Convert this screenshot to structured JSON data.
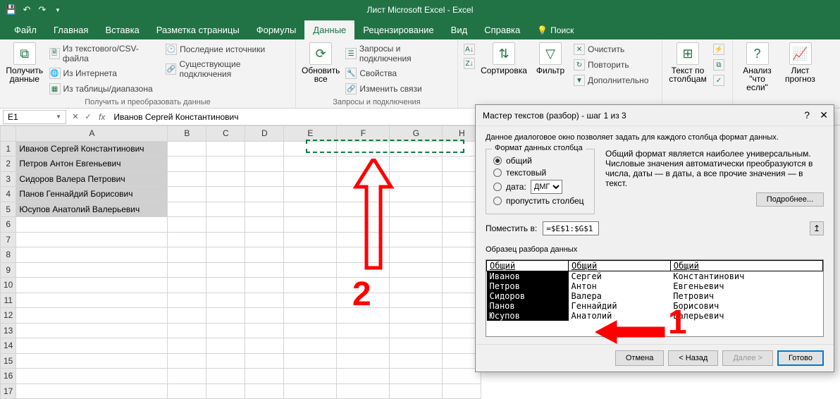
{
  "title": "Лист Microsoft Excel  -  Excel",
  "tabs": {
    "file": "Файл",
    "home": "Главная",
    "insert": "Вставка",
    "layout": "Разметка страницы",
    "formulas": "Формулы",
    "data": "Данные",
    "review": "Рецензирование",
    "view": "Вид",
    "help": "Справка",
    "search": "Поиск"
  },
  "ribbon": {
    "getdata": {
      "big": "Получить данные",
      "a": "Из текстового/CSV-файла",
      "b": "Из Интернета",
      "c": "Из таблицы/диапазона",
      "d": "Последние источники",
      "e": "Существующие подключения",
      "group": "Получить и преобразовать данные"
    },
    "refresh": {
      "big": "Обновить все",
      "a": "Запросы и подключения",
      "b": "Свойства",
      "c": "Изменить связи",
      "group": "Запросы и подключения"
    },
    "sort": {
      "sort": "Сортировка",
      "filter": "Фильтр",
      "clear": "Очистить",
      "reapply": "Повторить",
      "advanced": "Дополнительно"
    },
    "texttc": "Текст по столбцам",
    "whatif": "Анализ \"что если\"",
    "forecast": "Лист прогноз"
  },
  "namebox": "E1",
  "formula": "Иванов Сергей Константинович",
  "cols": [
    "A",
    "B",
    "C",
    "D",
    "E",
    "F",
    "G",
    "H"
  ],
  "rows": [
    "1",
    "2",
    "3",
    "4",
    "5",
    "6",
    "7",
    "8",
    "9",
    "10",
    "11",
    "12",
    "13",
    "14",
    "15",
    "16",
    "17"
  ],
  "cells": {
    "A1": "Иванов Сергей Константинович",
    "A2": "Петров Антон Евгеньевич",
    "A3": "Сидоров Валера Петрович",
    "A4": "Панов Геннайдий Борисович",
    "A5": "Юсупов Анатолий Валерьевич"
  },
  "dialog": {
    "title": "Мастер текстов (разбор) - шаг 1 из 3",
    "intro": "Данное диалоговое окно позволяет задать для каждого столбца формат данных.",
    "legend": "Формат данных столбца",
    "opt_general": "общий",
    "opt_text": "текстовый",
    "opt_date": "дата:",
    "date_val": "ДМГ",
    "opt_skip": "пропустить столбец",
    "info": "Общий формат является наиболее универсальным. Числовые значения автоматически преобразуются в числа, даты — в даты, а все прочие значения — в текст.",
    "more": "Подробнее...",
    "dest_label": "Поместить в:",
    "dest_value": "=$E$1:$G$1",
    "preview_label": "Образец разбора данных",
    "preview_hdr": "Общий",
    "preview_rows": [
      [
        "Иванов",
        "Сергей",
        "Константинович"
      ],
      [
        "Петров",
        "Антон",
        "Евгеньевич"
      ],
      [
        "Сидоров",
        "Валера",
        "Петрович"
      ],
      [
        "Панов",
        "Геннайдий",
        "Борисович"
      ],
      [
        "Юсупов",
        "Анатолий",
        "Валерьевич"
      ]
    ],
    "btn_cancel": "Отмена",
    "btn_back": "< Назад",
    "btn_next": "Далее >",
    "btn_finish": "Готово"
  },
  "annot": {
    "n1": "1",
    "n2": "2"
  }
}
